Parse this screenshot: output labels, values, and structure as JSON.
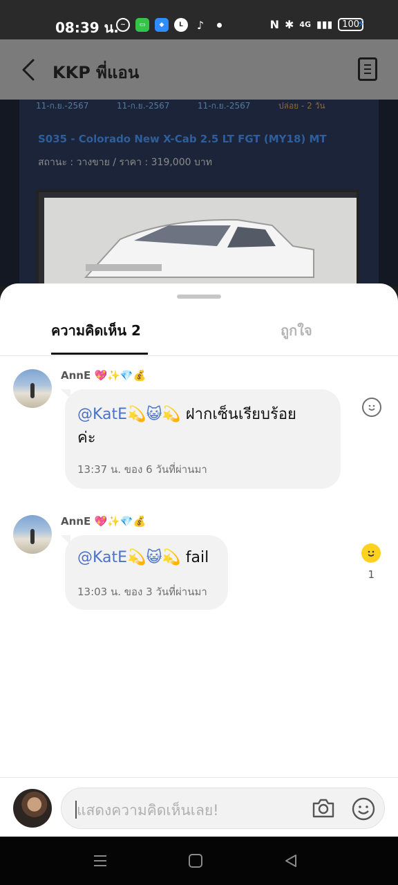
{
  "status_bar": {
    "time": "08:39 น.",
    "network": "4G",
    "battery": "100",
    "app_icons": [
      "messenger-icon",
      "messages-icon",
      "photo-app-icon",
      "line-icon",
      "tiktok-icon"
    ]
  },
  "header": {
    "title": "KKP พี่แอน"
  },
  "background_post": {
    "dates": [
      "11-ก.ย.-2567",
      "11-ก.ย.-2567",
      "11-ก.ย.-2567",
      "ปล่อย - 2 วัน"
    ],
    "car_title": "S035 - Colorado New X-Cab 2.5 LT FGT (MY18) MT",
    "car_status": "สถานะ : วางขาย / ราคา : 319,000 บาท"
  },
  "tabs": {
    "comments": "ความคิดเห็น 2",
    "likes": "ถูกใจ"
  },
  "comments": [
    {
      "author": "AnnE",
      "author_emoji": "💖✨💎💰",
      "mention": "@KatE💫😺💫",
      "text_line1": " ฝากเซ็นเรียบร้อย",
      "text_line2": "ค่ะ",
      "time": "13:37 น. ของ 6 วันที่ผ่านมา",
      "reaction_count": ""
    },
    {
      "author": "AnnE",
      "author_emoji": "💖✨💎💰",
      "mention": "@KatE💫😺💫",
      "text_line1": " fail",
      "time": "13:03 น. ของ 3 วันที่ผ่านมา",
      "reaction_count": "1"
    }
  ],
  "input": {
    "placeholder": "แสดงความคิดเห็นเลย!"
  },
  "colors": {
    "accent_mention": "#4a72c8",
    "reaction_active": "#ffd21e",
    "header_overlay": "#7b7b7b"
  }
}
